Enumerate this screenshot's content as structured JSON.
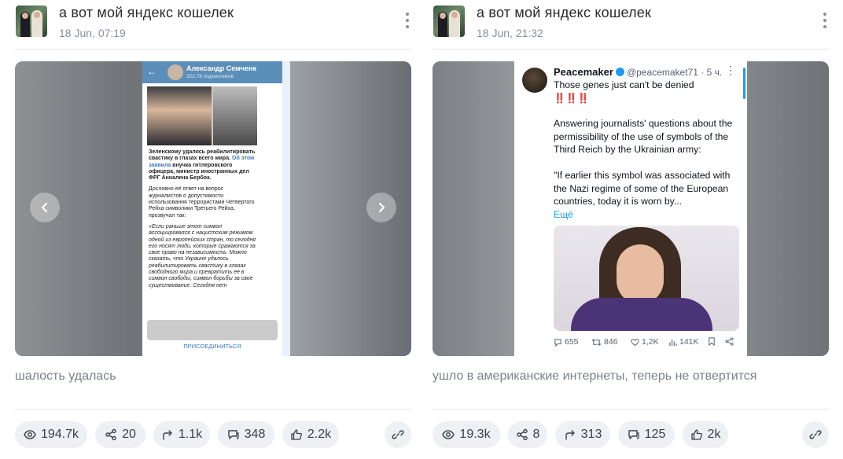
{
  "posts": [
    {
      "channel_title": "а вот мой яндекс кошелек",
      "date": "18 Jun, 07:19",
      "caption": "шалость удалась",
      "stats": {
        "views": "194.7k",
        "shares": "20",
        "forwards": "1.1k",
        "comments": "348",
        "likes": "2.2k"
      },
      "media": {
        "type": "telegram-screenshot",
        "header_name": "Александр Семченк",
        "header_sub": "322,7К подписчиков",
        "para1_bold": "Зеленскому удалось реабилитировать свастику в глазах всего мира.",
        "para1_link": "Об этом заявила",
        "para1_rest": "внучка гитлеровского офицера, министр иностранных дел ФРГ Анналена Бербок.",
        "para2": "Дословно её ответ на вопрос журналистов о допустимости использования террористами Четвертого Рейха символики Третьего Рейха, прозвучал так:",
        "para3": "«Если раньше этот символ ассоциировался с нацистским режимом одной из европейских стран, то сегодня его носят люди, которые сражаются за свое право на независимость. Можно сказать, что Украине удалось реабилитировать свастику в глазах свободного мира и превратить ее в символ свободы, символ борьбы за свое существование. Сегодня нет",
        "join_label": "ПРИСОЕДИНИТЬСЯ"
      }
    },
    {
      "channel_title": "а вот мой яндекс кошелек",
      "date": "18 Jun, 21:32",
      "caption": "ушло в американские интернеты, теперь не отвертится",
      "stats": {
        "views": "19.3k",
        "shares": "8",
        "forwards": "313",
        "comments": "125",
        "likes": "2k"
      },
      "media": {
        "type": "tweet-screenshot",
        "name": "Peacemaker",
        "handle": "@peacemaket71 · 5 ч.",
        "line1": "Those genes just can't be denied",
        "line2": "‼️‼️‼️",
        "line3": "Answering journalists' questions about the permissibility of the use of symbols of the Third Reich by the Ukrainian army:",
        "line4": "\"If earlier this symbol was associated with the Nazi regime of some of the European countries, today it is worn by...",
        "more": "Ещё",
        "replies": "655",
        "retweets": "846",
        "likes": "1,2K",
        "views": "141K"
      }
    }
  ],
  "icons": {
    "views": "eye-icon",
    "shares": "share-nodes-icon",
    "forwards": "forward-arrow-icon",
    "comments": "comment-icon",
    "likes": "thumbs-up-icon",
    "link": "link-icon",
    "menu": "kebab-menu-icon"
  }
}
